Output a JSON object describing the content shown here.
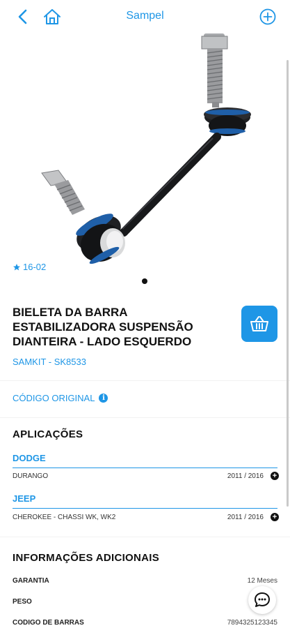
{
  "header": {
    "title": "Sampel",
    "back_icon": "chevron-left-icon",
    "home_icon": "home-icon",
    "add_icon": "plus-circle-icon"
  },
  "gallery": {
    "rating_icon": "star-icon",
    "rating": "16-02",
    "image_alt": "stabilizer link part photo"
  },
  "product": {
    "name": "BIELETA DA BARRA ESTABILIZADORA SUSPENSÃO DIANTEIRA - LADO ESQUERDO",
    "code": "SAMKIT - SK8533",
    "cart_icon": "basket-icon"
  },
  "original_code": {
    "label": "CÓDIGO ORIGINAL",
    "icon": "info-icon"
  },
  "applications": {
    "title": "APLICAÇÕES",
    "brands": [
      {
        "name": "DODGE",
        "rows": [
          {
            "model": "DURANGO",
            "years": "2011 / 2016"
          }
        ]
      },
      {
        "name": "JEEP",
        "rows": [
          {
            "model": "CHEROKEE - CHASSI WK, WK2",
            "years": "2011 / 2016"
          }
        ]
      }
    ]
  },
  "additional": {
    "title": "INFORMAÇÕES ADICIONAIS",
    "items": [
      {
        "label": "GARANTIA",
        "value": "12 Meses"
      },
      {
        "label": "PESO",
        "value": ""
      },
      {
        "label": "CODIGO DE BARRAS",
        "value": "7894325123345"
      }
    ]
  },
  "colors": {
    "accent": "#1e96e6",
    "background": "#f2f2f2"
  }
}
